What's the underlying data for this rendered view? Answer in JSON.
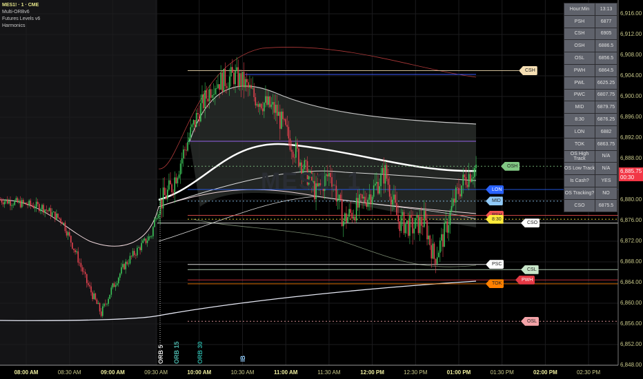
{
  "legend": {
    "symbol": "MES1! · 1 · CME",
    "indicators": [
      "Multi-ORBv6",
      "Futures Levels v6",
      "Harmonics"
    ]
  },
  "watermark": "MES1! 1",
  "table": [
    [
      "Hour:Min",
      "13:13"
    ],
    [
      "PSH",
      "6877"
    ],
    [
      "CSH",
      "6905"
    ],
    [
      "OSH",
      "6886.5"
    ],
    [
      "OSL",
      "6856.5"
    ],
    [
      "PWH",
      "6864.5"
    ],
    [
      "PWL",
      "6625.25"
    ],
    [
      "PWC",
      "6807.75"
    ],
    [
      "MID",
      "6879.75"
    ],
    [
      "8:30",
      "6876.25"
    ],
    [
      "LON",
      "6882"
    ],
    [
      "TOK",
      "6863.75"
    ],
    [
      "OS High Track",
      "N/A"
    ],
    [
      "OS Low Track",
      "N/A"
    ],
    [
      "Is Cash?",
      "YES"
    ],
    [
      "OS Tracking?",
      "NO"
    ],
    [
      "CSO",
      "6875.5"
    ]
  ],
  "current_price": {
    "value": "6,885.75",
    "countdown": "00:30",
    "color": "#f23645"
  },
  "session_markers": [
    "ORB 5",
    "ORB 15",
    "ORB 30",
    "IB"
  ],
  "chart_data": {
    "type": "candlestick",
    "title": "MES1! · 1 · CME",
    "ylim": [
      6846,
      6918
    ],
    "y_ticks": [
      "6,916.00",
      "6,912.00",
      "6,908.00",
      "6,904.00",
      "6,900.00",
      "6,896.00",
      "6,892.00",
      "6,888.00",
      "6,884.00",
      "6,880.00",
      "6,876.00",
      "6,872.00",
      "6,868.00",
      "6,864.00",
      "6,860.00",
      "6,856.00",
      "6,852.00",
      "6,848.00"
    ],
    "x_ticks": [
      {
        "label": "08:00 AM",
        "bold": true
      },
      {
        "label": "08:30 AM"
      },
      {
        "label": "09:00 AM",
        "bold": true
      },
      {
        "label": "09:30 AM"
      },
      {
        "label": "10:00 AM",
        "bold": true
      },
      {
        "label": "10:30 AM"
      },
      {
        "label": "11:00 AM",
        "bold": true
      },
      {
        "label": "11:30 AM"
      },
      {
        "label": "12:00 PM",
        "bold": true
      },
      {
        "label": "12:30 PM"
      },
      {
        "label": "01:00 PM",
        "bold": true
      },
      {
        "label": "01:30 PM"
      },
      {
        "label": "02:00 PM",
        "bold": true
      },
      {
        "label": "02:30 PM"
      }
    ],
    "price_path_minutes_from_0800": [
      -18,
      11,
      25,
      35,
      42,
      52,
      59,
      68,
      78,
      87,
      91,
      101,
      111,
      120,
      130,
      139,
      144,
      151,
      158,
      173,
      182,
      192,
      201,
      211,
      220,
      230,
      239,
      249,
      258,
      268,
      276,
      283,
      290,
      297,
      304,
      312
    ],
    "price_path_values": [
      6880,
      6878.6,
      6876,
      6869.3,
      6864,
      6858,
      6862.6,
      6867.3,
      6870.6,
      6873.3,
      6878.6,
      6882.6,
      6890.6,
      6897.3,
      6902.6,
      6903.3,
      6904,
      6902.6,
      6900,
      6897.3,
      6892,
      6886.6,
      6881.3,
      6885.3,
      6876,
      6878.6,
      6881.3,
      6885.3,
      6876,
      6874.6,
      6876,
      6868.7,
      6873.3,
      6880,
      6884,
      6886.4
    ],
    "levels": [
      {
        "name": "CSH",
        "value": 6905,
        "color": "#f5deb3"
      },
      {
        "name": "OSH",
        "value": 6886.5,
        "color": "#81c784"
      },
      {
        "name": "LON",
        "value": 6882,
        "color": "#2962ff"
      },
      {
        "name": "MID",
        "value": 6879.75,
        "color": "#90caf9"
      },
      {
        "name": "PSH",
        "value": 6877,
        "color": "#ef5350"
      },
      {
        "name": "8:30",
        "value": 6876.25,
        "color": "#ffeb3b"
      },
      {
        "name": "CSO",
        "value": 6875.5,
        "color": "#ffffff"
      },
      {
        "name": "PSC",
        "value": 6867.5,
        "color": "#ffffff"
      },
      {
        "name": "CSL",
        "value": 6866.5,
        "color": "#c8e6c9"
      },
      {
        "name": "PWH",
        "value": 6864.5,
        "color": "#e53945"
      },
      {
        "name": "TOK",
        "value": 6863.75,
        "color": "#ff8000"
      },
      {
        "name": "OSL",
        "value": 6856.5,
        "color": "#f4a3a8"
      }
    ]
  }
}
